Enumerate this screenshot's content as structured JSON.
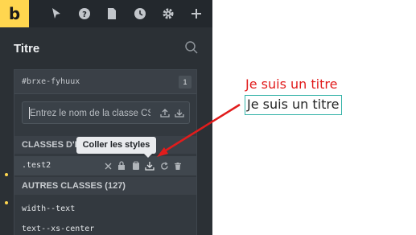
{
  "toolbar": {
    "logo": "b",
    "icons": [
      "cursor-icon",
      "help-icon",
      "page-icon",
      "history-icon",
      "settings-icon",
      "add-icon"
    ]
  },
  "panel": {
    "title": "Titre"
  },
  "class_manager": {
    "element_id": "#brxe-fyhuux",
    "count": "1",
    "input_placeholder": "Entrez le nom de la classe CSS ...",
    "active_section": "CLASSES D'É",
    "active_class": ".test2",
    "other_section": "AUTRES CLASSES (127)",
    "other_classes": [
      "width--text",
      "text--xs-center"
    ]
  },
  "tooltip": {
    "text": "Coller les styles"
  },
  "canvas": {
    "heading_red": "Je suis un titre",
    "heading_selected": "Je suis un titre"
  },
  "colors": {
    "accent_yellow": "#ffd64f",
    "annotation_red": "#e11c1c",
    "selection_teal": "#35b3a8"
  }
}
